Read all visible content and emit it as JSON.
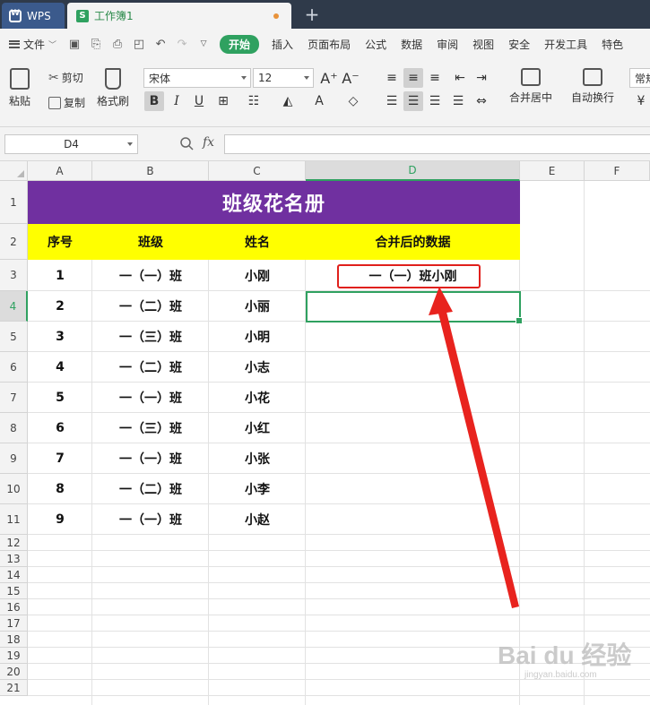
{
  "tabs": {
    "app": "WPS",
    "doc": "工作簿1",
    "add": "+"
  },
  "menu": {
    "file": "文件",
    "items": [
      "开始",
      "插入",
      "页面布局",
      "公式",
      "数据",
      "审阅",
      "视图",
      "安全",
      "开发工具",
      "特色"
    ],
    "active_index": 0
  },
  "ribbon": {
    "paste": "粘贴",
    "cut": "剪切",
    "copy": "复制",
    "format_painter": "格式刷",
    "font_name": "宋体",
    "font_size": "12",
    "bold": "B",
    "italic": "I",
    "underline": "U",
    "merge_center": "合并居中",
    "wrap_text": "自动换行",
    "number_format": "常规"
  },
  "formula_bar": {
    "name_box": "D4",
    "fx": "fx",
    "formula": ""
  },
  "grid": {
    "columns": [
      "A",
      "B",
      "C",
      "D",
      "E",
      "F"
    ],
    "selected_column": "D",
    "rows": [
      "1",
      "2",
      "3",
      "4",
      "5",
      "6",
      "7",
      "8",
      "9",
      "10",
      "11",
      "12",
      "13",
      "14",
      "15",
      "16",
      "17",
      "18",
      "19",
      "20",
      "21"
    ],
    "selected_row": "4",
    "title": "班级花名册",
    "headers": [
      "序号",
      "班级",
      "姓名",
      "合并后的数据"
    ],
    "data": [
      [
        "1",
        "一（一）班",
        "小刚",
        "一（一）班小刚"
      ],
      [
        "2",
        "一（二）班",
        "小丽",
        ""
      ],
      [
        "3",
        "一（三）班",
        "小明",
        ""
      ],
      [
        "4",
        "一（二）班",
        "小志",
        ""
      ],
      [
        "5",
        "一（一）班",
        "小花",
        ""
      ],
      [
        "6",
        "一（三）班",
        "小红",
        ""
      ],
      [
        "7",
        "一（一）班",
        "小张",
        ""
      ],
      [
        "8",
        "一（二）班",
        "小李",
        ""
      ],
      [
        "9",
        "一（一）班",
        "小赵",
        ""
      ]
    ]
  },
  "watermark": {
    "main": "Bai du 经验",
    "sub": "jingyan.baidu.com"
  },
  "colors": {
    "title_bg": "#7030a0",
    "header_bg": "#ffff00",
    "accent": "#2fa160",
    "annotation": "#e0201c"
  }
}
